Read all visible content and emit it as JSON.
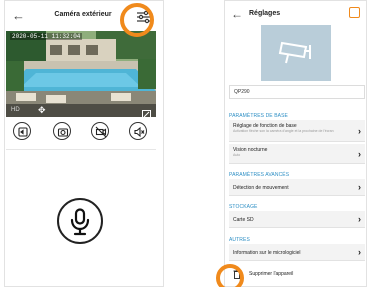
{
  "left_screen": {
    "back_icon": "arrow-left-icon",
    "title": "Caméra extérieur",
    "settings_icon": "sliders-icon",
    "video": {
      "timestamp": "2020-05-11 11:32:04",
      "quality": "HD",
      "move_icon": "move-arrows-icon",
      "fullscreen_icon": "expand-icon"
    },
    "controls": [
      {
        "name": "speaker-icon"
      },
      {
        "name": "camera-snapshot-icon"
      },
      {
        "name": "video-record-icon"
      },
      {
        "name": "mute-icon"
      }
    ],
    "mic_icon": "microphone-icon"
  },
  "right_screen": {
    "back_icon": "arrow-left-icon",
    "title": "Réglages",
    "device_name": "QP290",
    "sections": {
      "basic": "PARAMÈTRES DE BASE",
      "advanced": "PARAMÈTRES AVANCÉS",
      "storage": "STOCKAGE",
      "other": "AUTRES"
    },
    "rows": {
      "basic_function": {
        "title": "Réglage de fonction de base",
        "subtitle": "Activation flèche son la caméra d'angle et la prochaine de l'écran"
      },
      "night_vision": {
        "title": "Vision nocturne",
        "subtitle": "Auto"
      },
      "motion": {
        "title": "Détection de mouvement"
      },
      "sd": {
        "title": "Carte SD"
      },
      "firmware": {
        "title": "Information sur le micrologiciel"
      }
    },
    "delete_label": "Supprimer l'appareil"
  },
  "colors": {
    "accent_orange": "#f08a1c",
    "section_blue": "#2e8fc5",
    "row_bg": "#f3f3f3"
  }
}
